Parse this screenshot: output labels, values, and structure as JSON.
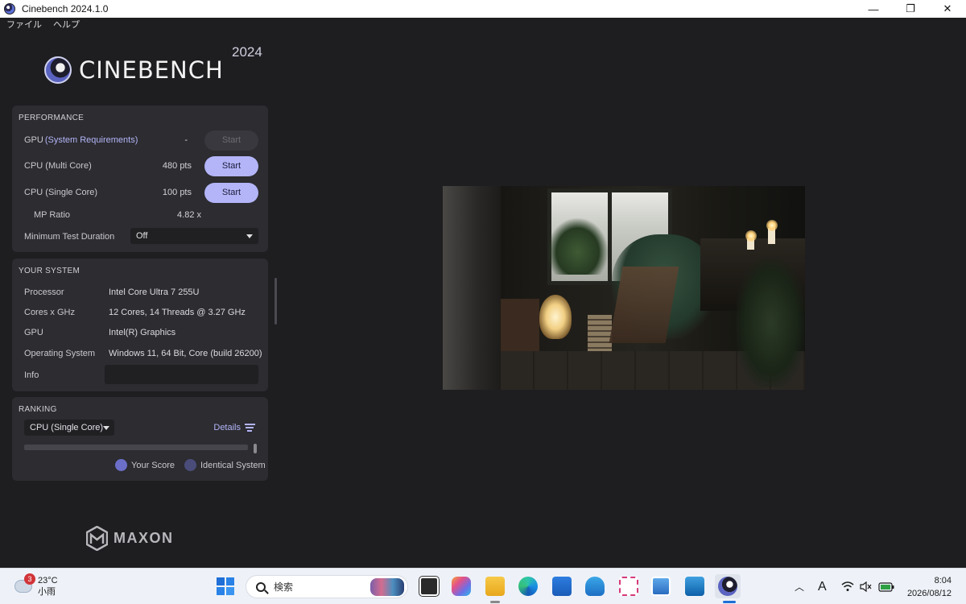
{
  "window": {
    "title": "Cinebench 2024.1.0",
    "controls": {
      "minimize": "—",
      "restore": "❐",
      "close": "✕"
    }
  },
  "menu": {
    "file": "ファイル",
    "help": "ヘルプ"
  },
  "logo": {
    "word": "CINEBENCH",
    "year": "2024"
  },
  "performance": {
    "heading": "PERFORMANCE",
    "gpu": {
      "label": "GPU",
      "link": "(System Requirements)",
      "value": "-",
      "button": "Start"
    },
    "cpu_multi": {
      "label": "CPU (Multi Core)",
      "value": "480 pts",
      "button": "Start"
    },
    "cpu_single": {
      "label": "CPU (Single Core)",
      "value": "100 pts",
      "button": "Start"
    },
    "mp_ratio": {
      "label": "MP Ratio",
      "value": "4.82 x"
    },
    "min_duration": {
      "label": "Minimum Test Duration",
      "value": "Off"
    }
  },
  "system": {
    "heading": "YOUR SYSTEM",
    "rows": [
      {
        "label": "Processor",
        "value": "Intel Core Ultra 7 255U"
      },
      {
        "label": "Cores x GHz",
        "value": "12 Cores, 14 Threads @ 3.27 GHz"
      },
      {
        "label": "GPU",
        "value": "Intel(R) Graphics"
      },
      {
        "label": "Operating System",
        "value": "Windows 11, 64 Bit, Core (build 26200)"
      },
      {
        "label": "Info",
        "value": ""
      }
    ]
  },
  "ranking": {
    "heading": "RANKING",
    "selected": "CPU (Single Core)",
    "details": "Details",
    "legend": {
      "your_score": "Your Score",
      "identical": "Identical System"
    },
    "colors": {
      "your_score": "#6b6fc8",
      "identical": "#4a4d7a"
    }
  },
  "brand": {
    "maxon": "MAXON"
  },
  "taskbar": {
    "weather": {
      "badge": "3",
      "temp": "23°C",
      "condition": "小雨"
    },
    "search_placeholder": "検索",
    "tray": {
      "ime": "A"
    },
    "clock": {
      "time": "8:04",
      "date": "2026/08/12"
    }
  },
  "theme": {
    "accent": "#b3b5f8",
    "background": "#1e1e21",
    "card": "#2c2c31"
  }
}
